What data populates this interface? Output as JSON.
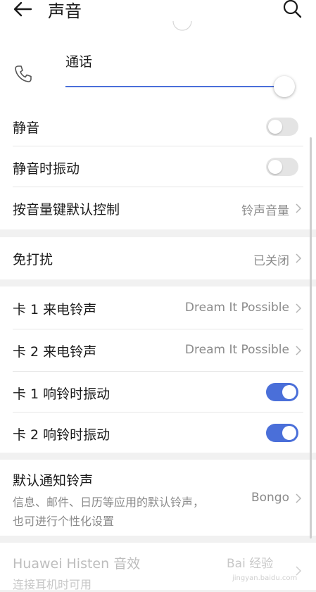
{
  "header": {
    "title": "声音"
  },
  "call_volume": {
    "label": "通话",
    "level": 1.0
  },
  "settings_group_1": {
    "mute_label": "静音",
    "mute_on": false,
    "vibrate_on_mute_label": "静音时振动",
    "vibrate_on_mute_on": false,
    "volume_key_label": "按音量键默认控制",
    "volume_key_value": "铃声音量"
  },
  "dnd": {
    "label": "免打扰",
    "value": "已关闭"
  },
  "ringtones": {
    "sim1_ringtone_label": "卡 1 来电铃声",
    "sim1_ringtone_value": "Dream It Possible",
    "sim2_ringtone_label": "卡 2 来电铃声",
    "sim2_ringtone_value": "Dream It Possible",
    "sim1_vibrate_label": "卡 1 响铃时振动",
    "sim1_vibrate_on": true,
    "sim2_vibrate_label": "卡 2 响铃时振动",
    "sim2_vibrate_on": true
  },
  "notification": {
    "label": "默认通知铃声",
    "desc_line1": "信息、邮件、日历等应用的默认铃声，",
    "desc_line2": "也可进行个性化设置",
    "value": "Bongo"
  },
  "histen": {
    "label": "Huawei Histen 音效",
    "desc": "连接耳机时可用"
  },
  "watermark": {
    "text": "Bai 经验",
    "sub": "jingyan.baidu.com"
  },
  "colors": {
    "accent": "#4a6fd9",
    "background": "#f1f1f1",
    "card": "#ffffff",
    "secondary_text": "#8a8a8a"
  }
}
